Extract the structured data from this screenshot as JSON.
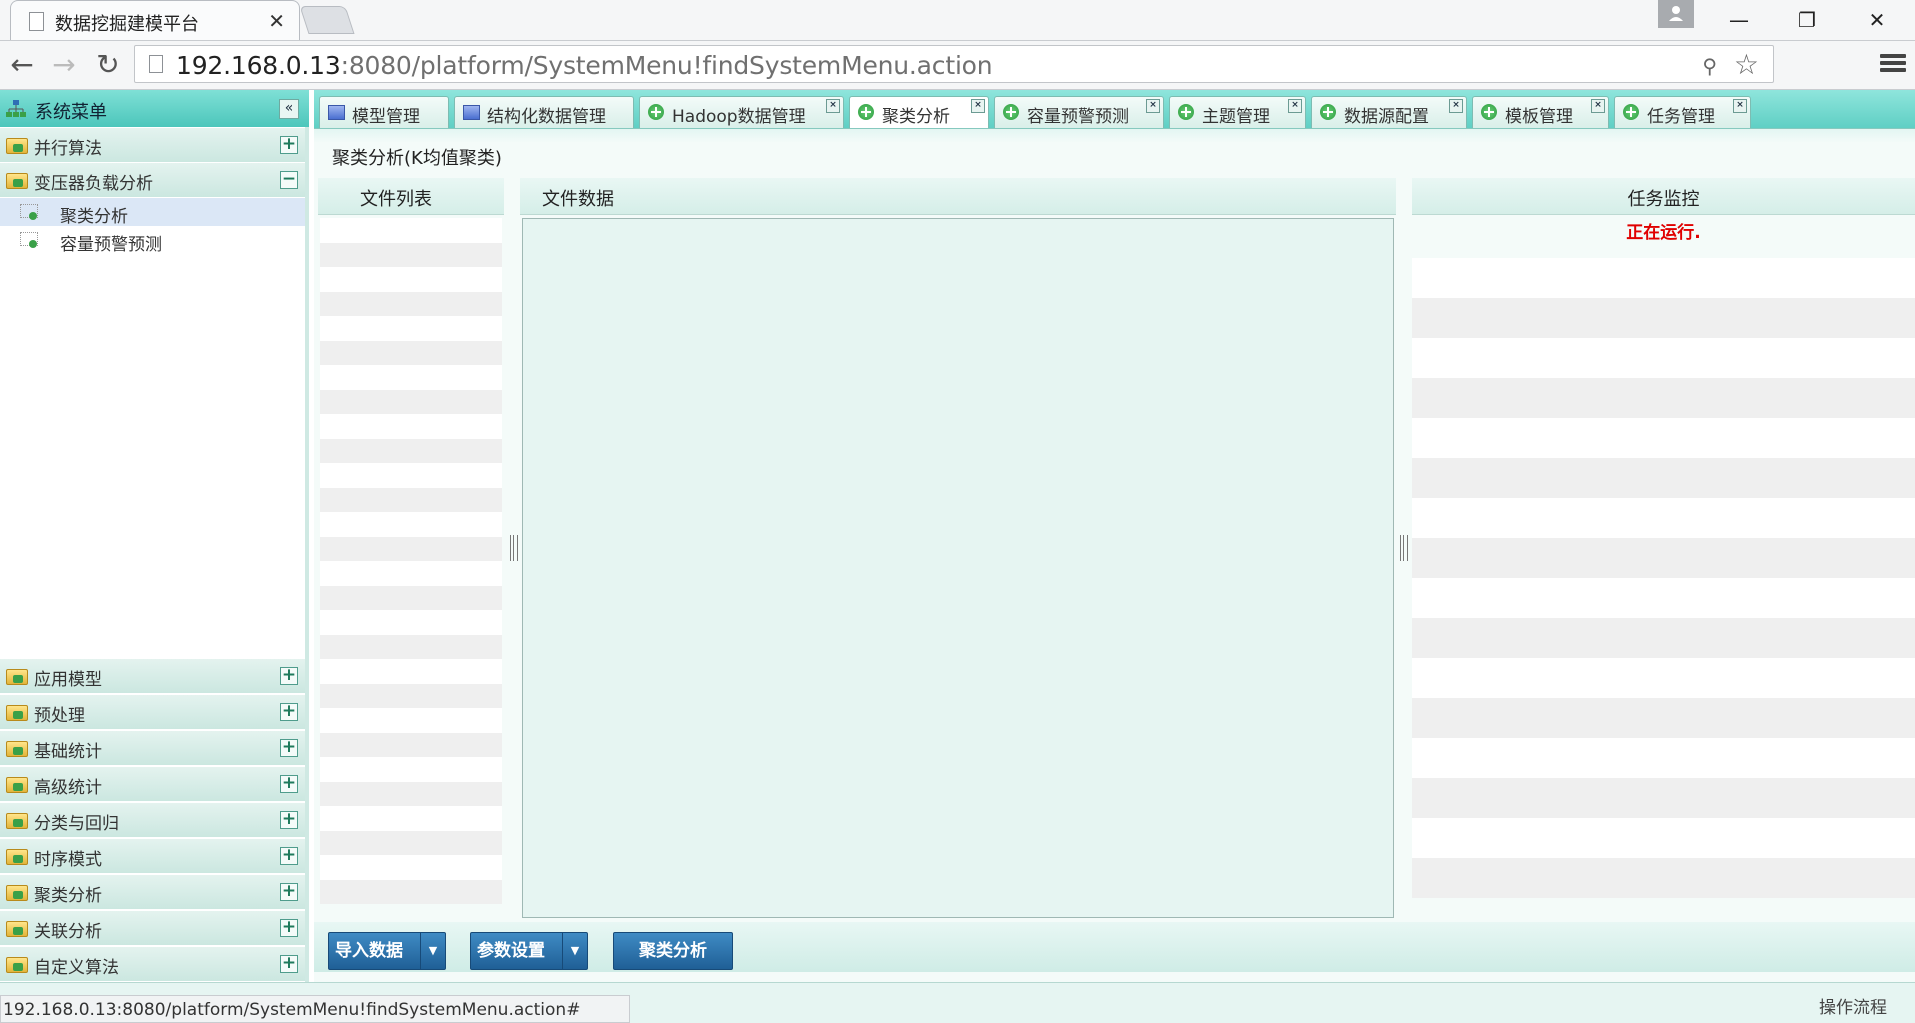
{
  "browser": {
    "tab_title": "数据挖掘建模平台",
    "tab_close": "✕",
    "url_host": "192.168.0.13",
    "url_rest": ":8080/platform/SystemMenu!findSystemMenu.action"
  },
  "sidebar": {
    "title": "系统菜单",
    "collapse_glyph": "«",
    "expanded_section": {
      "label": "并行算法",
      "toggle": "+"
    },
    "open_section": {
      "label": "变压器负载分析",
      "toggle": "−",
      "items": [
        {
          "label": "聚类分析"
        },
        {
          "label": "容量预警预测"
        }
      ]
    },
    "bottom_sections": [
      {
        "label": "应用模型",
        "toggle": "+"
      },
      {
        "label": "预处理",
        "toggle": "+"
      },
      {
        "label": "基础统计",
        "toggle": "+"
      },
      {
        "label": "高级统计",
        "toggle": "+"
      },
      {
        "label": "分类与回归",
        "toggle": "+"
      },
      {
        "label": "时序模式",
        "toggle": "+"
      },
      {
        "label": "聚类分析",
        "toggle": "+"
      },
      {
        "label": "关联分析",
        "toggle": "+"
      },
      {
        "label": "自定义算法",
        "toggle": "+"
      }
    ]
  },
  "tabs": [
    {
      "label": "模型管理",
      "icon": "window-icon"
    },
    {
      "label": "结构化数据管理",
      "icon": "window-icon"
    },
    {
      "label": "Hadoop数据管理",
      "icon": "plus-circle-icon"
    },
    {
      "label": "聚类分析",
      "icon": "plus-circle-icon"
    },
    {
      "label": "容量预警预测",
      "icon": "plus-circle-icon"
    },
    {
      "label": "主题管理",
      "icon": "plus-circle-icon"
    },
    {
      "label": "数据源配置",
      "icon": "plus-circle-icon"
    },
    {
      "label": "模板管理",
      "icon": "plus-circle-icon"
    },
    {
      "label": "任务管理",
      "icon": "plus-circle-icon"
    }
  ],
  "tab_close_glyph": "×",
  "page": {
    "heading": "聚类分析(K均值聚类)",
    "file_list_title": "文件列表",
    "file_data_title": "文件数据",
    "monitor_title": "任务监控",
    "monitor_status": "正在运行."
  },
  "actions": {
    "import_label": "导入数据",
    "params_label": "参数设置",
    "run_label": "聚类分析",
    "caret": "▼"
  },
  "statusbar": {
    "url_preview": "192.168.0.13:8080/platform/SystemMenu!findSystemMenu.action#",
    "flow_label": "操作流程"
  },
  "colors": {
    "accent_teal": "#5fcfc4",
    "status_running": "#e00000",
    "button_blue": "#2f78b4"
  }
}
